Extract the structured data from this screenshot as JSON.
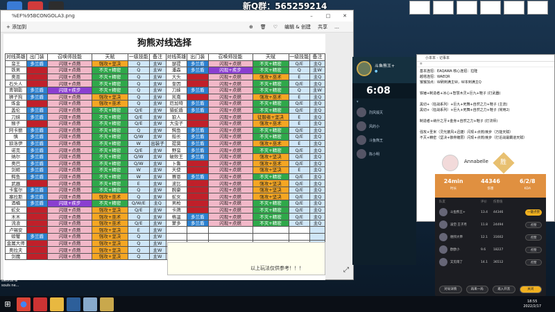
{
  "window": {
    "title": "%EF%95BCONGOLA3.png"
  },
  "streamer": {
    "qq_group": "新Q群：565259214"
  },
  "photo": {
    "toolbar_left": "+ 添加到",
    "toolbar_right": [
      "编辑 & 创建",
      "共享"
    ],
    "sheet_title": "狗熊对线选择",
    "headers": [
      "对线英雄",
      "出门装",
      "召唤师技能",
      "天赋",
      "一级技能",
      "备注",
      "对线英雄",
      "出门装",
      "召唤师技能",
      "天赋",
      "一级技能",
      "备注"
    ],
    "rows": [
      [
        "蛮王",
        "多兰盾",
        "闪现+点燃",
        "强攻+坚决",
        "Q",
        "主W",
        "瑟提",
        "多兰盾",
        "闪现+点燃",
        "不灭+精密",
        "Q/E",
        "主Q"
      ],
      [
        "铁男",
        "多兰剑",
        "闪现+点燃",
        "不灭+精密",
        "Q",
        "主W",
        "潘森",
        "多兰盾",
        "闪现+疾步",
        "不灭+精密",
        "Q",
        "主W"
      ],
      [
        "奥恩",
        "多兰戒",
        "闪现+点燃",
        "不灭+精密",
        "Q",
        "主W",
        "大头",
        "多兰戒",
        "闪现+点燃",
        "强攻+巫术",
        "E",
        "主Q"
      ],
      [
        "石头人",
        "多兰戒",
        "闪现+点燃",
        "不灭+精密",
        "Q",
        "主W",
        "奎因",
        "多兰剑",
        "闪现+点燃",
        "不灭+精密",
        "Q/E",
        "主Q"
      ],
      [
        "青钢影",
        "多兰盾",
        "闪现+疾步",
        "不灭+精密",
        "Q",
        "主W",
        "刀妹",
        "多兰盾",
        "闪现+点燃",
        "不灭+精密",
        "Q",
        "主W"
      ],
      [
        "狮子狗",
        "多兰盾",
        "闪现+点燃",
        "强攻+坚决",
        "Q",
        "主W",
        "凯南",
        "多兰戒",
        "闪现+点燃",
        "强攻+巫术",
        "E",
        "主Q"
      ],
      [
        "炼金",
        "多兰戒",
        "闪现+点燃",
        "强攻+巫术",
        "Q",
        "主W",
        "厄加特",
        "多兰盾",
        "闪现+点燃",
        "不灭+精密",
        "Q/E",
        "主Q"
      ],
      [
        "盖伦",
        "多兰盾",
        "闪现+点燃",
        "不灭+精密",
        "Q/E",
        "主W",
        "猎蛇盾",
        "多兰盾",
        "闪现+点燃",
        "不灭+精密",
        "Q/E",
        "主Q"
      ],
      [
        "刀妹",
        "多兰盾",
        "闪现+点燃",
        "不灭+精密",
        "Q/E",
        "主W",
        "狼人",
        "多兰剑",
        "闪现+点燃",
        "征服者+坚决",
        "E",
        "主Q"
      ],
      [
        "猴子",
        "多兰剑",
        "闪现+点燃",
        "不灭+精密",
        "Q/E",
        "主W",
        "大虫子",
        "多兰戒",
        "闪现+点燃",
        "强攻+巫术",
        "E",
        "主Q"
      ],
      [
        "阿卡丽",
        "多兰盾",
        "闪现+点燃",
        "不灭+精密",
        "Q",
        "主W",
        "鳄鱼",
        "多兰盾",
        "闪现+点燃",
        "不灭+精密",
        "Q/E",
        "主Q"
      ],
      [
        "慎",
        "多兰盾",
        "闪现+点燃",
        "不灭+精密",
        "Q/W",
        "主W",
        "船长",
        "多兰盾",
        "闪现+点燃",
        "不灭+精密",
        "Q/E",
        "主Q"
      ],
      [
        "狼洛伊",
        "多兰盾",
        "闪现+点燃",
        "不灭+精密",
        "W",
        "出装子",
        "提莫",
        "多兰盾",
        "闪现+点燃",
        "强攻+巫术",
        "E",
        "主Q"
      ],
      [
        "诺克",
        "多兰盾",
        "闪现+点燃",
        "不灭+精密",
        "Q/E",
        "主W",
        "野蛮",
        "多兰盾",
        "闪现+点燃",
        "不灭+精密",
        "Q/E",
        "主Q"
      ],
      [
        "纳尔",
        "多兰盾",
        "闪现+点燃",
        "不灭+精密",
        "Q/W",
        "主W",
        "破败王",
        "多兰盾",
        "闪现+点燃",
        "强攻+坚决",
        "Q/E",
        "主Q"
      ],
      [
        "奥巴",
        "多兰盾",
        "闪现+点燃",
        "不灭+精密",
        "Q/W",
        "主W",
        "卜鲁",
        "多兰戒",
        "闪现+点燃",
        "强攻+巫术",
        "Q/E",
        "主Q"
      ],
      [
        "剑姬",
        "多兰盾",
        "闪现+点燃",
        "不灭+精密",
        "W",
        "主W",
        "天使",
        "多兰剑",
        "闪现+点燃",
        "强攻+坚决",
        "E",
        "主Q"
      ],
      [
        "鳄鱼",
        "多兰盾",
        "闪现+点燃",
        "不灭+精密",
        "W",
        "主W",
        "赛恩",
        "多兰盾",
        "闪现+点燃",
        "不灭+精密",
        "Q/E",
        "主Q"
      ],
      [
        "武器",
        "多兰剑",
        "闪现+点燃",
        "不灭+精密",
        "E",
        "主W",
        "波比",
        "多兰戒",
        "闪现+点燃",
        "强攻+坚决",
        "Q/E",
        "主Q"
      ],
      [
        "卡蜜尔",
        "多兰盾",
        "闪现+点燃",
        "不灭+精密",
        "Q",
        "主W",
        "腕豪",
        "多兰戒",
        "闪现+点燃",
        "强攻+坚决",
        "Q/E",
        "主Q"
      ],
      [
        "塞拉斯",
        "多兰盾",
        "闪现+点燃",
        "强攻+巫术",
        "Q",
        "主W",
        "蛇女",
        "多兰戒",
        "闪现+点燃",
        "强攻+坚决",
        "Q/E",
        "主Q"
      ],
      [
        "酒桶",
        "多兰盾",
        "闪现+疾步",
        "不灭+精密",
        "Q/W/E",
        "主Q",
        "男枪",
        "多兰剑",
        "闪现+点燃",
        "不灭+精密",
        "Q/E",
        "主Q"
      ],
      [
        "蛇女",
        "多兰戒",
        "闪现+点燃",
        "强攻+坚决",
        "Q/E",
        "主W",
        "卡牌",
        "多兰戒",
        "闪现+点燃",
        "不灭+精密",
        "Q/E",
        "主Q"
      ],
      [
        "木木",
        "多兰戒",
        "闪现+点燃",
        "强攻+巫术",
        "Q",
        "主W",
        "格温",
        "多兰盾",
        "闪现+点燃",
        "不灭+精密",
        "Q/E",
        "主Q"
      ],
      [
        "流浪",
        "多兰戒",
        "闪现+点燃",
        "强攻+巫术",
        "Q/E",
        "主W",
        "蒙多",
        "多兰盾",
        "闪现+点燃",
        "不灭+精密",
        "Q/E",
        "主Q"
      ],
      [
        "卢锡安",
        "多兰剑",
        "闪现+点燃",
        "强攻+坚决",
        "E",
        "主W",
        "",
        "",
        "",
        "",
        "",
        ""
      ],
      [
        "螃蟹",
        "多兰盾",
        "闪现+点燃",
        "强攻+坚决",
        "Q",
        "主W",
        "",
        "",
        "",
        "",
        "",
        ""
      ],
      [
        "金属大师",
        "多兰戒",
        "闪现+点燃",
        "强攻+坚决",
        "Q",
        "主W",
        "",
        "",
        "",
        "",
        "",
        ""
      ],
      [
        "奥拉夫",
        "多兰剑",
        "闪现+点燃",
        "强攻+坚决",
        "Q",
        "主W",
        "",
        "",
        "",
        "",
        "",
        ""
      ],
      [
        "剑魔",
        "多兰剑",
        "闪现+点燃",
        "强攻+坚决",
        "Q",
        "主W",
        "",
        "",
        "",
        "",
        "",
        ""
      ]
    ],
    "notes_main": "以上玩法仅供参考！！！"
  },
  "game": {
    "player": "斗鱼熊王+",
    "timer": "6:08",
    "friends": [
      "烈风毁灭",
      "风的小",
      "斗鱼熊王",
      "陈小明"
    ]
  },
  "notepad": {
    "title": "小本本 - 记事本",
    "lines": [
      "基本连招：EAQAWA    核心连招：拉隆",
      "越塔连招：WAEQR",
      "猴猴加点：W刷到满主W，W本到满主Q",
      "",
      "铁锤+制造者+冰心+智慧木灵+巨九+鞋子         (打武器)",
      "",
      "黑切+（狂战系列）+巨九+死舞+自然之力+鞋子       (主流)",
      "黑切+（狂战系列）+巨九+死舞+自然之力+鞋子       (常用2)",
      "",
      "制造者+纳什之牙+金身+自然之力+鞋子            (打法师)",
      "",
      "强攻+圣米（灵光披风+迅捷）闪现+点燃/疾步（万能天赋）",
      "不灭+精密（坚决+骸骨镀层）闪现+点燃/疾步（打近战最霸道天赋）"
    ]
  },
  "profile": {
    "name": "Annabelle",
    "badge": "胜",
    "stats": [
      {
        "value": "24min",
        "label": "时长"
      },
      {
        "value": "44346",
        "label": "伤害"
      },
      {
        "value": "6/2/8",
        "label": "KDA"
      }
    ],
    "col_headers": [
      "队友",
      "评价",
      "伤害值"
    ],
    "players": [
      {
        "name": "斗鱼熊王+",
        "score": "13.4",
        "dmg": "44346",
        "btn": "一键点赞"
      },
      {
        "name": "凌空·王子月",
        "score": "11.8",
        "dmg": "24494",
        "btn": "点赞"
      },
      {
        "name": "德邦大帝",
        "score": "12.1",
        "dmg": "31602",
        "btn": "点赞"
      },
      {
        "name": "欧欧小",
        "score": "9.6",
        "dmg": "18227",
        "btn": "点赞"
      },
      {
        "name": "又见雨了",
        "score": "14.1",
        "dmg": "36512",
        "btn": "点赞"
      }
    ],
    "footer": [
      "对局详情",
      "再来一局",
      "邀入开黑",
      "关闭"
    ]
  },
  "taskbar": {
    "time": "18:55",
    "date": "2022/2/17"
  },
  "desktop_text": [
    "swords &",
    "souls ne..."
  ]
}
